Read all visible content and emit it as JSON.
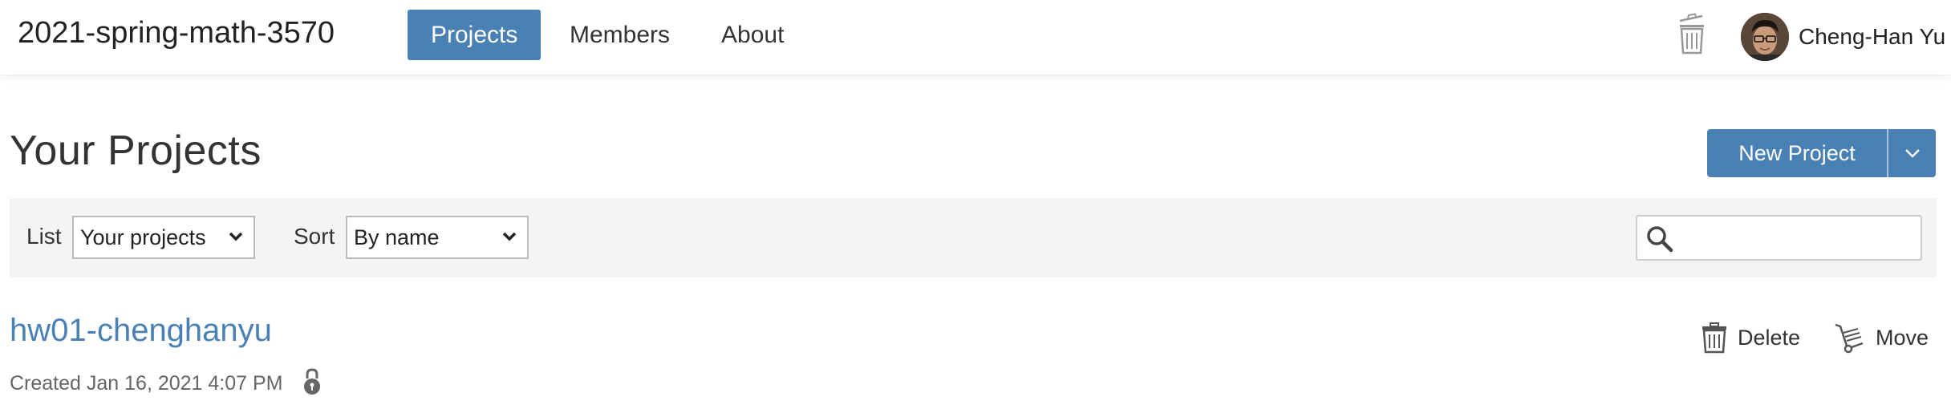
{
  "header": {
    "course_title": "2021-spring-math-3570",
    "nav": {
      "projects": "Projects",
      "members": "Members",
      "about": "About"
    },
    "active_tab": "Projects",
    "user_name": "Cheng-Han Yu"
  },
  "main": {
    "heading": "Your Projects",
    "new_project_label": "New Project"
  },
  "filters": {
    "list_label": "List",
    "list_value": "Your projects",
    "sort_label": "Sort",
    "sort_value": "By name",
    "search_value": ""
  },
  "projects": [
    {
      "name": "hw01-chenghanyu",
      "created": "Created Jan 16, 2021 4:07 PM",
      "delete_label": "Delete",
      "move_label": "Move"
    }
  ],
  "colors": {
    "accent": "#4a81b4",
    "filter_bg": "#f5f4f4"
  },
  "icons": [
    "trash-icon",
    "avatar",
    "chevron-down-icon",
    "search-icon",
    "lock-icon",
    "hand-truck-icon"
  ]
}
